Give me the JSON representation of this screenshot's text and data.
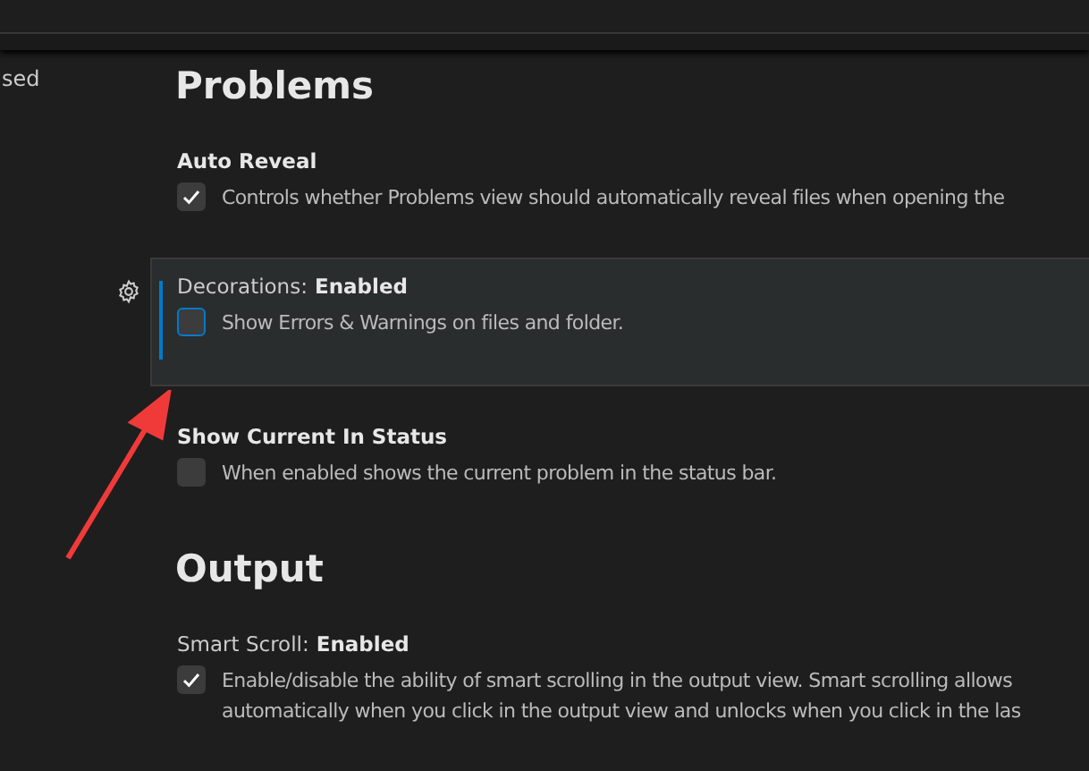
{
  "sidebar": {
    "fragment": "sed"
  },
  "sections": [
    {
      "title": "Problems",
      "settings": [
        {
          "label": "Auto Reveal",
          "checked": true,
          "focused": false,
          "description": [
            "Controls whether Problems view should automatically reveal files when opening the"
          ]
        },
        {
          "label": "Decorations:",
          "value": "Enabled",
          "checked": false,
          "focused": true,
          "description": [
            "Show Errors & Warnings on files and folder."
          ]
        },
        {
          "label": "Show Current In Status",
          "checked": false,
          "focused": false,
          "description": [
            "When enabled shows the current problem in the status bar."
          ]
        }
      ]
    },
    {
      "title": "Output",
      "settings": [
        {
          "label": "Smart Scroll:",
          "value": "Enabled",
          "checked": true,
          "focused": false,
          "description": [
            "Enable/disable the ability of smart scrolling in the output view. Smart scrolling allows",
            "automatically when you click in the output view and unlocks when you click in the las"
          ]
        }
      ]
    }
  ]
}
